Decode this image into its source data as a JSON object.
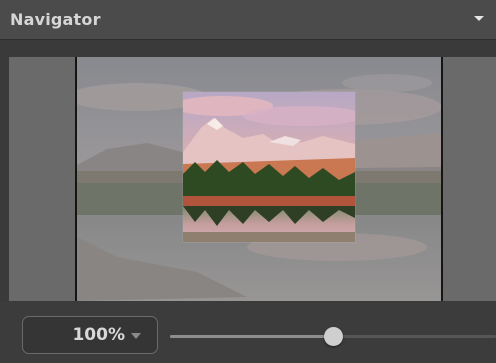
{
  "navigator": {
    "title": "Navigator",
    "menu_icon": "triangle-down-icon"
  },
  "preview": {
    "image_icon": "mountain-lake-landscape-image"
  },
  "zoom": {
    "value": "100%",
    "caret_icon": "triangle-down-icon",
    "slider_position_fraction": 0.5
  },
  "colors": {
    "panel_bg": "#3a3a3a",
    "header_bg": "#4b4b4b",
    "title_text": "#d6d6d6",
    "viewport_bg": "#6a6a6a",
    "frame_border": "#151515",
    "slider_thumb": "#cfcfcf"
  }
}
